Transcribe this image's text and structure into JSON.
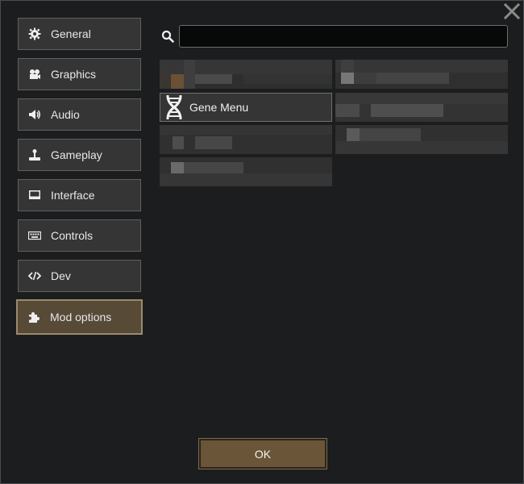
{
  "nav": {
    "items": [
      {
        "label": "General",
        "icon": "gear-icon"
      },
      {
        "label": "Graphics",
        "icon": "camera-icon"
      },
      {
        "label": "Audio",
        "icon": "speaker-icon"
      },
      {
        "label": "Gameplay",
        "icon": "joystick-icon"
      },
      {
        "label": "Interface",
        "icon": "monitor-icon"
      },
      {
        "label": "Controls",
        "icon": "keyboard-icon"
      },
      {
        "label": "Dev",
        "icon": "code-icon"
      },
      {
        "label": "Mod options",
        "icon": "puzzle-icon",
        "selected": true
      }
    ]
  },
  "search": {
    "value": "",
    "placeholder": ""
  },
  "mods": {
    "gene_menu_label": "Gene Menu",
    "gene_menu_icon": "dna-icon"
  },
  "footer": {
    "ok_label": "OK"
  },
  "colors": {
    "accent": "#574a37",
    "accent_border": "#9b8a6a",
    "ok_button": "#6b5538",
    "background": "#1b1d1f"
  }
}
